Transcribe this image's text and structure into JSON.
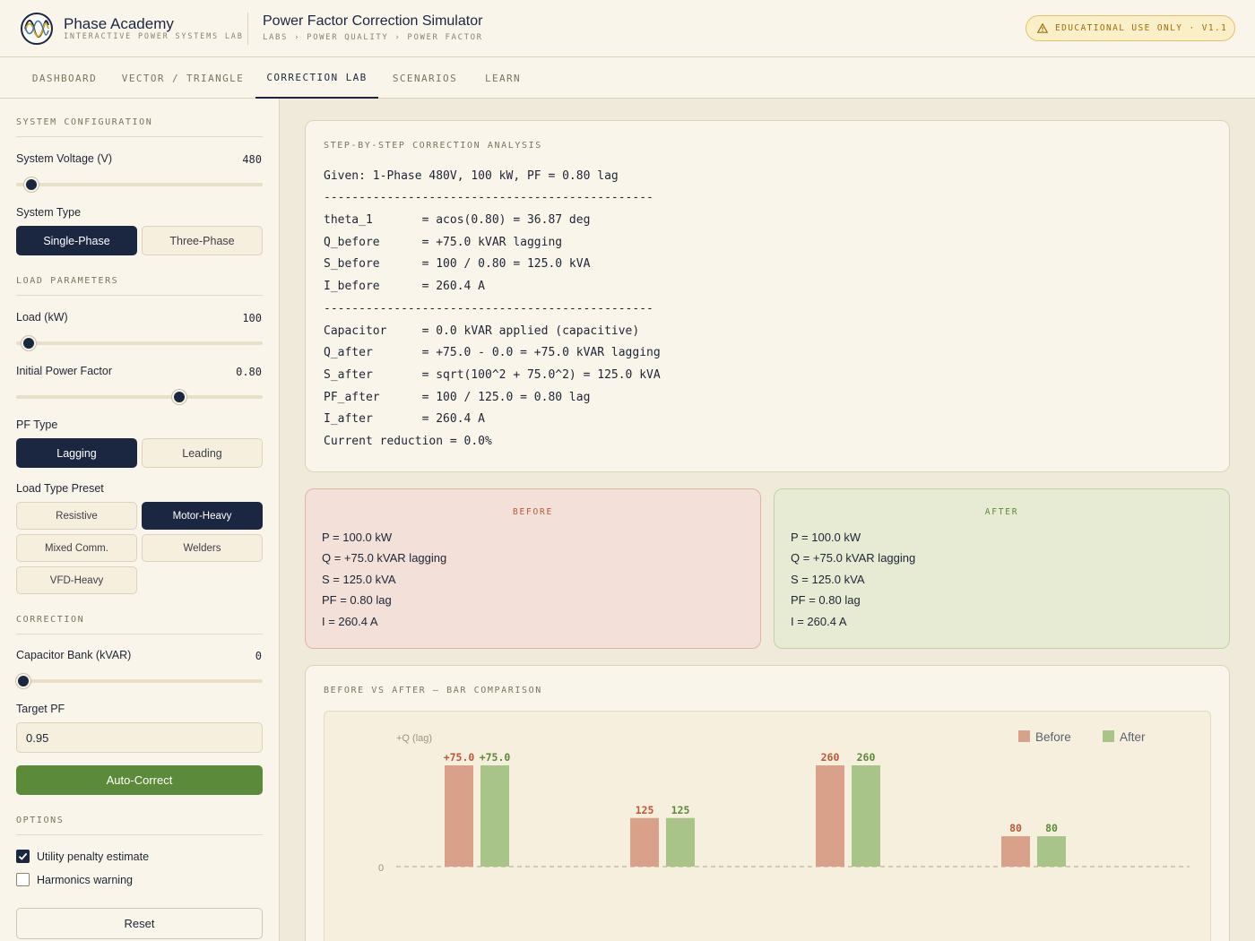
{
  "brand": {
    "name": "Phase Academy",
    "subtitle": "INTERACTIVE POWER SYSTEMS LAB"
  },
  "header": {
    "title": "Power Factor Correction Simulator",
    "breadcrumb": "LABS › POWER QUALITY › POWER FACTOR",
    "badge": "EDUCATIONAL USE ONLY · V1.1"
  },
  "nav": {
    "tabs": [
      {
        "label": "DASHBOARD",
        "active": false
      },
      {
        "label": "VECTOR / TRIANGLE",
        "active": false
      },
      {
        "label": "CORRECTION LAB",
        "active": true
      },
      {
        "label": "SCENARIOS",
        "active": false
      },
      {
        "label": "LEARN",
        "active": false
      }
    ]
  },
  "sidebar": {
    "system_config": {
      "title": "SYSTEM CONFIGURATION",
      "voltage_label": "System Voltage (V)",
      "voltage_value": "480",
      "voltage_slider_fraction": 0.06,
      "system_type_label": "System Type",
      "system_types": [
        {
          "label": "Single-Phase",
          "active": true
        },
        {
          "label": "Three-Phase",
          "active": false
        }
      ]
    },
    "load": {
      "title": "LOAD PARAMETERS",
      "load_label": "Load (kW)",
      "load_value": "100",
      "load_slider_fraction": 0.05,
      "pf_label": "Initial Power Factor",
      "pf_value": "0.80",
      "pf_slider_fraction": 0.66,
      "pf_type_label": "PF Type",
      "pf_types": [
        {
          "label": "Lagging",
          "active": true
        },
        {
          "label": "Leading",
          "active": false
        }
      ],
      "preset_label": "Load Type Preset",
      "presets": [
        {
          "label": "Resistive",
          "active": false
        },
        {
          "label": "Motor-Heavy",
          "active": true
        },
        {
          "label": "Mixed Comm.",
          "active": false
        },
        {
          "label": "Welders",
          "active": false
        },
        {
          "label": "VFD-Heavy",
          "active": false
        }
      ]
    },
    "correction": {
      "title": "CORRECTION",
      "cap_label": "Capacitor Bank (kVAR)",
      "cap_value": "0",
      "cap_slider_fraction": 0.03,
      "target_label": "Target PF",
      "target_value": "0.95",
      "auto_label": "Auto-Correct"
    },
    "options": {
      "title": "OPTIONS",
      "items": [
        {
          "label": "Utility penalty estimate",
          "checked": true
        },
        {
          "label": "Harmonics warning",
          "checked": false
        }
      ],
      "reset_label": "Reset"
    }
  },
  "analysis": {
    "title": "STEP-BY-STEP CORRECTION ANALYSIS",
    "lines": [
      "Given: 1-Phase 480V, 100 kW, PF = 0.80 lag",
      "-----------------------------------------------",
      "theta_1       = acos(0.80) = 36.87 deg",
      "Q_before      = +75.0 kVAR lagging",
      "S_before      = 100 / 0.80 = 125.0 kVA",
      "I_before      = 260.4 A",
      "",
      "-----------------------------------------------",
      "Capacitor     = 0.0 kVAR applied (capacitive)",
      "Q_after       = +75.0 - 0.0 = +75.0 kVAR lagging",
      "S_after       = sqrt(100^2 + 75.0^2) = 125.0 kVA",
      "PF_after      = 100 / 125.0 = 0.80 lag",
      "I_after       = 260.4 A",
      "Current reduction = 0.0%"
    ]
  },
  "before": {
    "title": "BEFORE",
    "lines": [
      "P = 100.0 kW",
      "Q = +75.0 kVAR lagging",
      "S = 125.0 kVA",
      "PF = 0.80 lag",
      "I = 260.4 A"
    ]
  },
  "after": {
    "title": "AFTER",
    "lines": [
      "P = 100.0 kW",
      "Q = +75.0 kVAR lagging",
      "S = 125.0 kVA",
      "PF = 0.80 lag",
      "I = 260.4 A"
    ]
  },
  "comparison": {
    "title": "BEFORE VS AFTER — BAR COMPARISON"
  },
  "chart_data": {
    "type": "bar",
    "axis_label": "+Q (lag)",
    "zero_label": "0",
    "legend_position": "top-right",
    "series": [
      {
        "name": "Before",
        "color": "#d9a08a",
        "label_color": "#c0573b",
        "values": [
          75.0,
          125,
          260,
          80
        ],
        "labels": [
          "+75.0",
          "125",
          "260",
          "80"
        ]
      },
      {
        "name": "After",
        "color": "#a8c489",
        "label_color": "#5b8a3a",
        "values": [
          75.0,
          125,
          260,
          80
        ],
        "labels": [
          "+75.0",
          "125",
          "260",
          "80"
        ]
      }
    ],
    "normalized_heights": [
      1.0,
      0.48,
      1.0,
      0.3
    ]
  },
  "colors": {
    "navy": "#1b2640",
    "green": "#5b8a3a",
    "before_bg": "#f3e0d8",
    "after_bg": "#e8ebd4"
  }
}
